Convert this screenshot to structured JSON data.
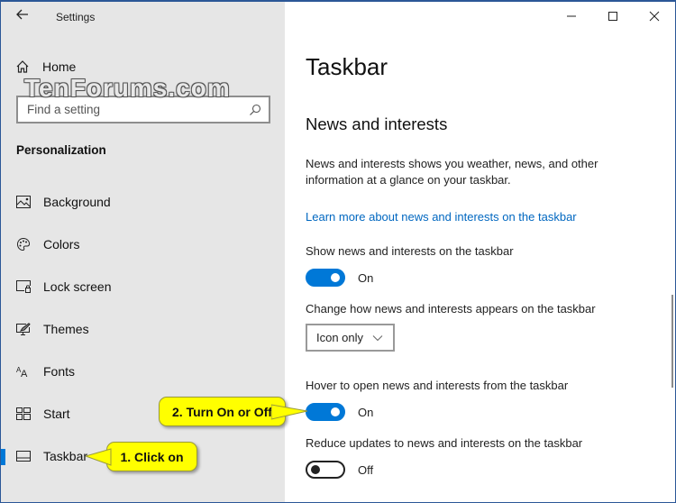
{
  "window": {
    "app_title": "Settings",
    "controls": {
      "minimize": "minimize-icon",
      "maximize": "maximize-icon",
      "close": "close-icon"
    }
  },
  "watermark": "TenForums.com",
  "sidebar": {
    "back_icon": "back-arrow-icon",
    "home_label": "Home",
    "search": {
      "placeholder": "Find a setting",
      "value": ""
    },
    "section_heading": "Personalization",
    "items": [
      {
        "id": "background",
        "label": "Background",
        "icon": "background-icon",
        "selected": false
      },
      {
        "id": "colors",
        "label": "Colors",
        "icon": "palette-icon",
        "selected": false
      },
      {
        "id": "lock-screen",
        "label": "Lock screen",
        "icon": "lock-screen-icon",
        "selected": false
      },
      {
        "id": "themes",
        "label": "Themes",
        "icon": "themes-icon",
        "selected": false
      },
      {
        "id": "fonts",
        "label": "Fonts",
        "icon": "fonts-icon",
        "selected": false
      },
      {
        "id": "start",
        "label": "Start",
        "icon": "start-icon",
        "selected": false
      },
      {
        "id": "taskbar",
        "label": "Taskbar",
        "icon": "taskbar-icon",
        "selected": true
      }
    ],
    "accent_color": "#0078d7"
  },
  "main": {
    "page_title": "Taskbar",
    "subheading": "News and interests",
    "description": "News and interests shows you weather, news, and other information at a glance on your taskbar.",
    "link_text": "Learn more about news and interests on the taskbar",
    "settings": {
      "show": {
        "label": "Show news and interests on the taskbar",
        "state": "On",
        "enabled": true
      },
      "appearance": {
        "label": "Change how news and interests appears on the taskbar",
        "selected_value": "Icon only"
      },
      "hover": {
        "label": "Hover to open news and interests from the taskbar",
        "state": "On",
        "enabled": true
      },
      "reduce_updates": {
        "label": "Reduce updates to news and interests on the taskbar",
        "state": "Off",
        "enabled": false
      }
    }
  },
  "callouts": {
    "step1": "1. Click on",
    "step2": "2. Turn On or Off",
    "color": "#ffff00"
  }
}
